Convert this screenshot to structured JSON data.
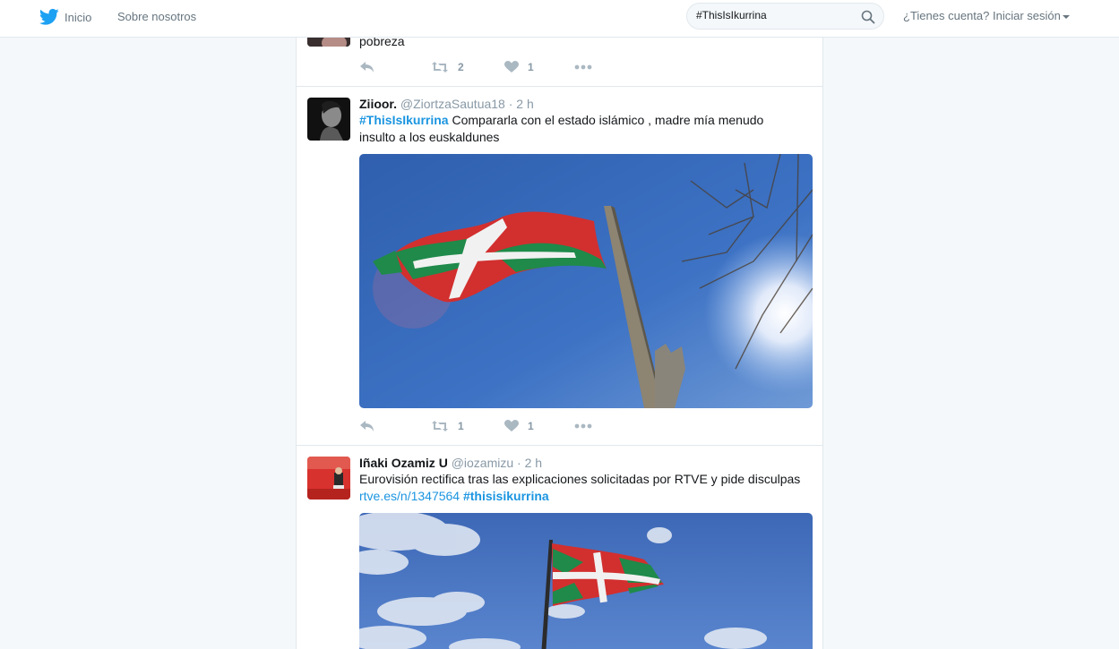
{
  "nav": {
    "home_label": "Inicio",
    "about_label": "Sobre nosotros"
  },
  "search": {
    "value": "#ThisIsIkurrina"
  },
  "account": {
    "prompt": "¿Tienes cuenta?",
    "login_label": "Iniciar sesión"
  },
  "tweets": [
    {
      "text_tail": "pobreza",
      "retweets": "2",
      "likes": "1"
    },
    {
      "name": "Ziioor.",
      "handle": "@ZiortzaSautua18",
      "separator": "·",
      "time": "2 h",
      "hashtag": "#ThisIsIkurrina",
      "text_line1": " Compararla con el estado islámico , madre mía menudo",
      "text_line2": "insulto a los euskaldunes",
      "retweets": "1",
      "likes": "1"
    },
    {
      "name": "Iñaki Ozamiz U",
      "handle": "@iozamizu",
      "separator": "·",
      "time": "2 h",
      "text_line1": "Eurovisión rectifica tras las explicaciones solicitadas por RTVE y pide disculpas",
      "link": "rtve.es/n/1347564",
      "hashtag": "#thisisikurrina"
    }
  ],
  "colors": {
    "link": "#1b95e0",
    "twitter_blue": "#1da1f2",
    "muted": "#8899a6"
  }
}
